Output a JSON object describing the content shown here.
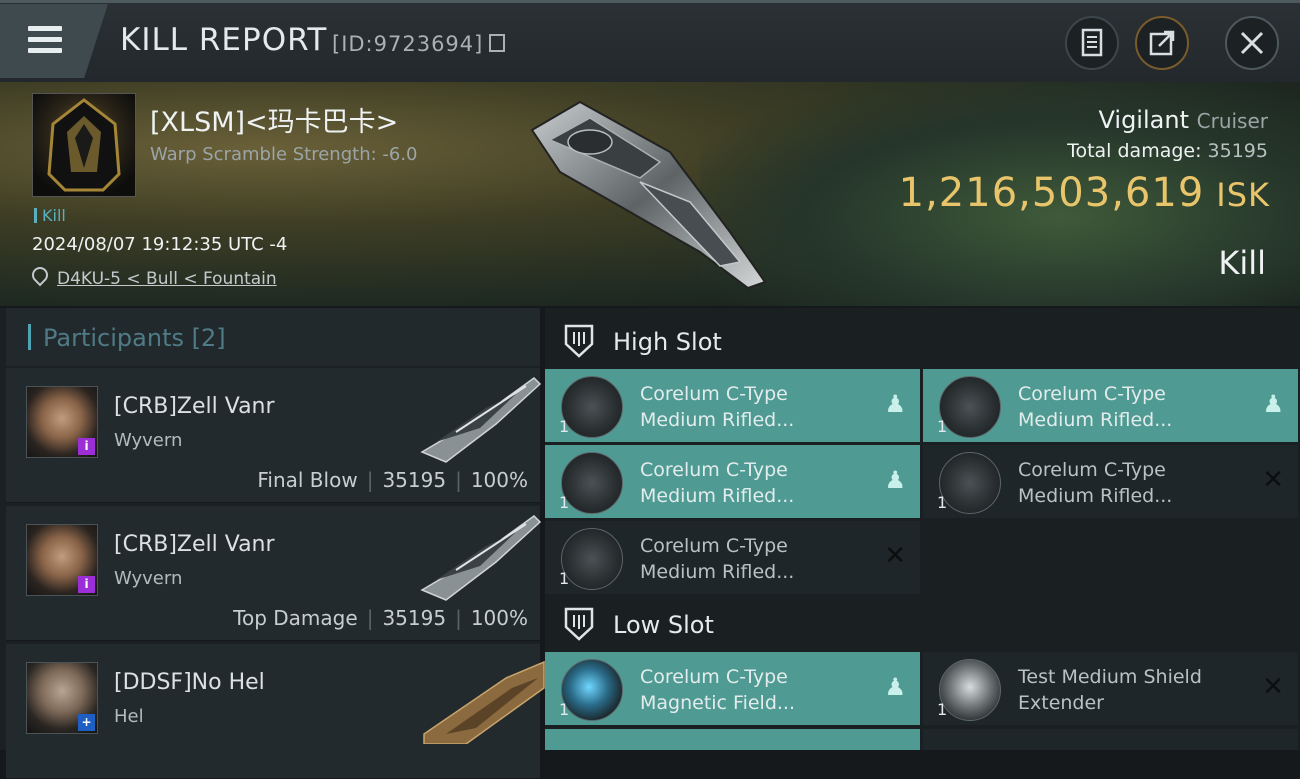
{
  "header": {
    "title": "KILL REPORT",
    "id_label": "[ID:9723694]",
    "buttons": [
      "menu-icon",
      "report-icon",
      "share-icon",
      "close-icon"
    ]
  },
  "victim": {
    "name": "[XLSM]<玛卡巴卡>",
    "warp_scramble": "Warp Scramble Strength: -6.0",
    "tag": "Kill",
    "timestamp": "2024/08/07 19:12:35 UTC -4",
    "location": "D4KU-5 < Bull < Fountain",
    "ship_name": "Vigilant",
    "ship_class": "Cruiser",
    "total_damage_label": "Total damage:",
    "total_damage": "35195",
    "isk_value": "1,216,503,619",
    "isk_unit": "ISK",
    "result": "Kill"
  },
  "participants": {
    "title": "Participants",
    "count": "[2]",
    "rows": [
      {
        "name": "[CRB]Zell Vanr",
        "ship": "Wyvern",
        "role": "Final Blow",
        "damage": "35195",
        "percent": "100%",
        "badge": "i",
        "badge_color": "#9b2ed6"
      },
      {
        "name": "[CRB]Zell Vanr",
        "ship": "Wyvern",
        "role": "Top Damage",
        "damage": "35195",
        "percent": "100%",
        "badge": "i",
        "badge_color": "#9b2ed6"
      },
      {
        "name": "[DDSF]No Hel",
        "ship": "Hel",
        "role": "",
        "damage": "",
        "percent": "",
        "badge": "+",
        "badge_color": "#1f5fc4"
      }
    ]
  },
  "modules": {
    "high_slot": {
      "title": "High Slot",
      "items": [
        {
          "qty": "1",
          "line1": "Corelum C-Type",
          "line2": "Medium Rifled...",
          "state": "dropped"
        },
        {
          "qty": "1",
          "line1": "Corelum C-Type",
          "line2": "Medium Rifled...",
          "state": "dropped"
        },
        {
          "qty": "1",
          "line1": "Corelum C-Type",
          "line2": "Medium Rifled...",
          "state": "dropped"
        },
        {
          "qty": "1",
          "line1": "Corelum C-Type",
          "line2": "Medium Rifled...",
          "state": "destroyed"
        },
        {
          "qty": "1",
          "line1": "Corelum C-Type",
          "line2": "Medium Rifled...",
          "state": "destroyed"
        }
      ]
    },
    "low_slot": {
      "title": "Low Slot",
      "items": [
        {
          "qty": "1",
          "line1": "Corelum C-Type",
          "line2": "Magnetic Field...",
          "state": "dropped"
        },
        {
          "qty": "1",
          "line1": "Test Medium Shield",
          "line2": "Extender",
          "state": "destroyed"
        }
      ]
    }
  },
  "colors": {
    "accent": "#4f9a92",
    "isk": "#e8c56b",
    "teal_text": "#58b0c0"
  }
}
